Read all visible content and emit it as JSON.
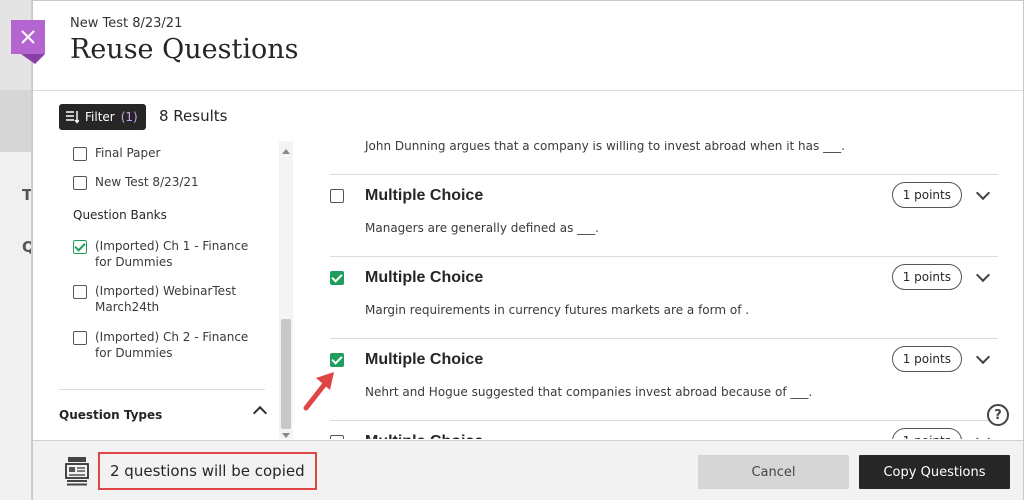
{
  "background": {
    "fragments": [
      "Te",
      "Q"
    ]
  },
  "header": {
    "breadcrumb": "New Test 8/23/21",
    "title": "Reuse Questions"
  },
  "filterbar": {
    "filter_label": "Filter",
    "filter_count": "(1)",
    "results": "8 Results"
  },
  "sidebar": {
    "assessments": [
      {
        "label": "Final Paper",
        "checked": false
      },
      {
        "label": "New Test 8/23/21",
        "checked": false
      }
    ],
    "question_banks_heading": "Question Banks",
    "question_banks": [
      {
        "label": "(Imported) Ch 1 - Finance for Dummies",
        "checked": true
      },
      {
        "label": "(Imported) WebinarTestMarch24th",
        "checked": false
      },
      {
        "label": "(Imported) Ch 2 - Finance for Dummies",
        "checked": false
      }
    ],
    "question_types_heading": "Question Types"
  },
  "questions": [
    {
      "type": "",
      "text": "John Dunning argues that a company is willing to invest abroad when it has ___.",
      "points": "",
      "checked": false
    },
    {
      "type": "Multiple Choice",
      "text": "Managers are generally defined as ___.",
      "points": "1 points",
      "checked": false
    },
    {
      "type": "Multiple Choice",
      "text": "Margin requirements in currency futures markets are a form of       .",
      "points": "1 points",
      "checked": true
    },
    {
      "type": "Multiple Choice",
      "text": "Nehrt and Hogue suggested that companies invest abroad because of ___.",
      "points": "1 points",
      "checked": true
    },
    {
      "type": "Multiple Choice",
      "text": "",
      "points": "1 points",
      "checked": false
    }
  ],
  "footer": {
    "copied_status": "2 questions will be copied",
    "cancel_label": "Cancel",
    "copy_label": "Copy Questions"
  },
  "icons": {
    "close": "close-icon",
    "filter": "filter-sort-icon",
    "help": "help-icon",
    "copy_status": "question-stack-icon",
    "annotation": "red-arrow-annotation"
  },
  "colors": {
    "accent_purple": "#b565d0",
    "check_green": "#1f9e5b",
    "annotation_red": "#e04545",
    "primary_button": "#262626"
  },
  "help_glyph": "?"
}
